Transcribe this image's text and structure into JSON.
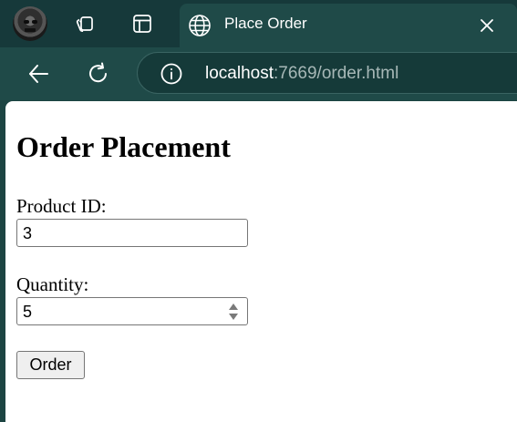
{
  "browser": {
    "tab": {
      "title": "Place Order"
    },
    "address_bar": {
      "host": "localhost",
      "rest": ":7669/order.html"
    }
  },
  "page": {
    "heading": "Order Placement",
    "form": {
      "product_id": {
        "label": "Product ID:",
        "value": "3"
      },
      "quantity": {
        "label": "Quantity:",
        "value": "5"
      },
      "submit_label": "Order"
    }
  },
  "colors": {
    "tabstrip_bg": "#16393a",
    "toolbar_bg": "#1f4a48",
    "page_bg": "#ffffff"
  }
}
